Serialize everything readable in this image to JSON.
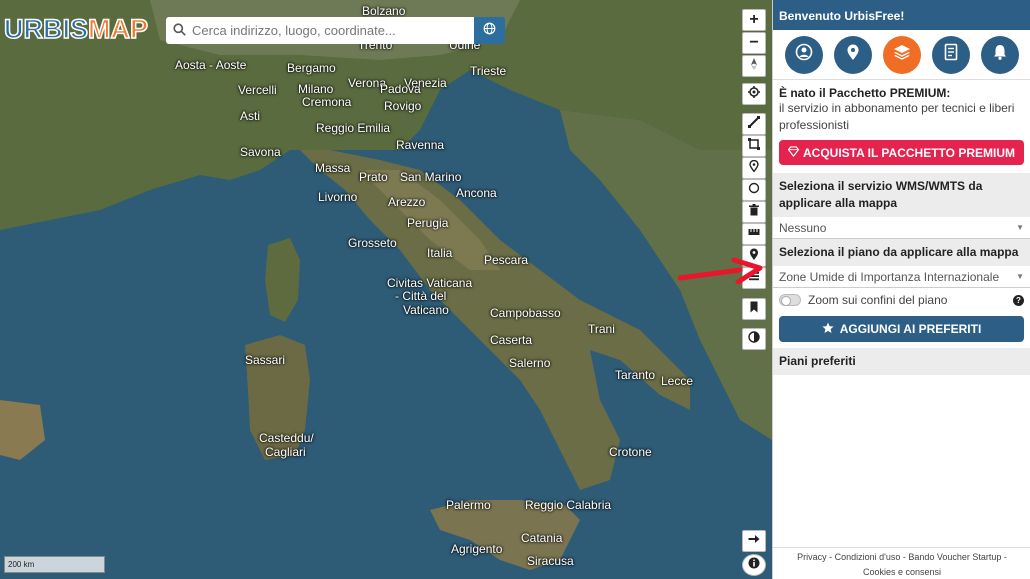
{
  "logo": {
    "part1": "URBIS",
    "part2": "MAP"
  },
  "search": {
    "placeholder": "Cerca indirizzo, luogo, coordinate..."
  },
  "map": {
    "cities": [
      {
        "name": "Bolzano"
      },
      {
        "name": "Trento"
      },
      {
        "name": "Udine"
      },
      {
        "name": "Trieste"
      },
      {
        "name": "Aosta - Aoste"
      },
      {
        "name": "Bergamo"
      },
      {
        "name": "Verona"
      },
      {
        "name": "Venezia"
      },
      {
        "name": "Vercelli"
      },
      {
        "name": "Milano"
      },
      {
        "name": "Padova"
      },
      {
        "name": "Cremona"
      },
      {
        "name": "Rovigo"
      },
      {
        "name": "Asti"
      },
      {
        "name": "Reggio Emilia"
      },
      {
        "name": "Ravenna"
      },
      {
        "name": "Savona"
      },
      {
        "name": "Massa"
      },
      {
        "name": "Prato"
      },
      {
        "name": "San Marino"
      },
      {
        "name": "Ancona"
      },
      {
        "name": "Livorno"
      },
      {
        "name": "Arezzo"
      },
      {
        "name": "Perugia"
      },
      {
        "name": "Grosseto"
      },
      {
        "name": "Italia"
      },
      {
        "name": "Pescara"
      },
      {
        "name": "Civitas Vaticana"
      },
      {
        "name": "- Città del"
      },
      {
        "name": "Vaticano"
      },
      {
        "name": "Campobasso"
      },
      {
        "name": "Trani"
      },
      {
        "name": "Sassari"
      },
      {
        "name": "Caserta"
      },
      {
        "name": "Salerno"
      },
      {
        "name": "Taranto"
      },
      {
        "name": "Lecce"
      },
      {
        "name": "Casteddu/"
      },
      {
        "name": "Cagliari"
      },
      {
        "name": "Crotone"
      },
      {
        "name": "Palermo"
      },
      {
        "name": "Reggio Calabria"
      },
      {
        "name": "Catania"
      },
      {
        "name": "Agrigento"
      },
      {
        "name": "Siracusa"
      }
    ],
    "scale_label": "200 km"
  },
  "toolbar": {
    "zoom_in": "+",
    "zoom_out": "−"
  },
  "sidebar": {
    "header": "Benvenuto UrbisFree!",
    "premium_title": "È nato il Pacchetto PREMIUM:",
    "premium_text": "il servizio in abbonamento per tecnici e liberi professionisti",
    "buy_button": "ACQUISTA IL PACCHETTO PREMIUM",
    "wms_title": "Seleziona il servizio WMS/WMTS da applicare alla mappa",
    "wms_value": "Nessuno",
    "plan_title": "Seleziona il piano da applicare alla mappa",
    "plan_value": "Zone Umide di Importanza Internazionale",
    "zoom_toggle_label": "Zoom sui confini del piano",
    "help_glyph": "?",
    "fav_button": "AGGIUNGI AI PREFERITI",
    "fav_section": "Piani preferiti",
    "footer_line1": "Privacy - Condizioni d'uso - Bando Voucher Startup -",
    "footer_line2": "Cookies e consensi"
  },
  "colors": {
    "brand_blue": "#2d5f86",
    "brand_orange": "#ef6d25",
    "premium_red": "#e4234f",
    "arrow_red": "#e8152b"
  }
}
